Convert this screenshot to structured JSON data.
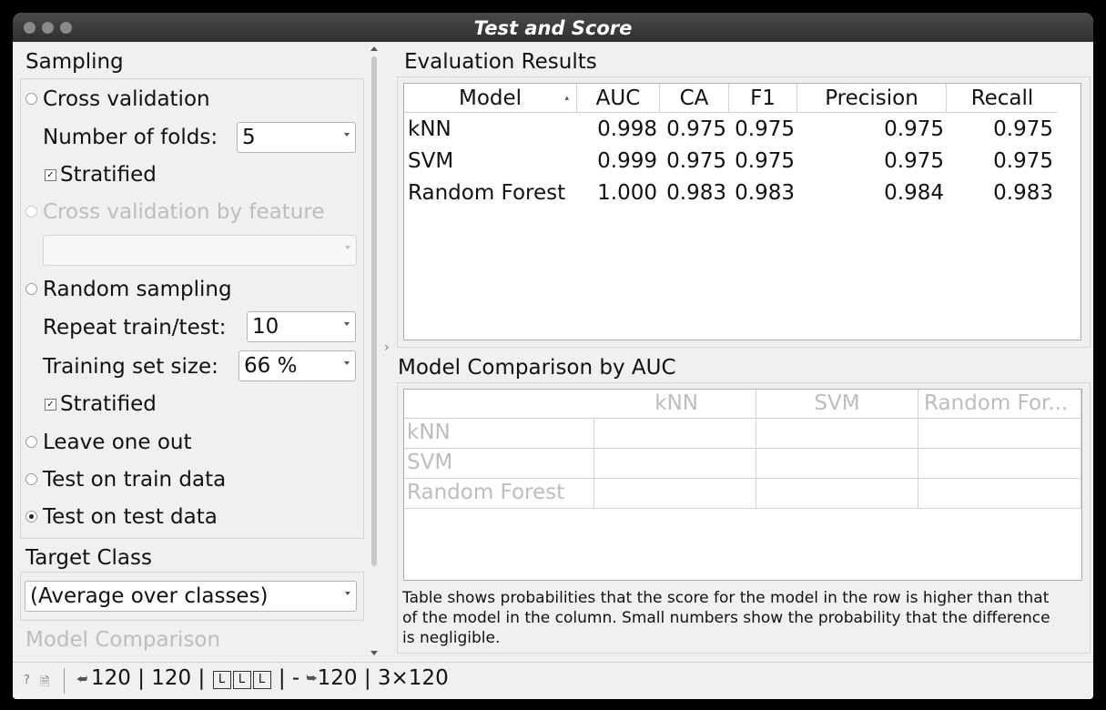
{
  "window": {
    "title": "Test and Score"
  },
  "sampling": {
    "header": "Sampling",
    "cross_validation": "Cross validation",
    "folds_label": "Number of folds:",
    "folds_value": "5",
    "stratified": "Stratified",
    "cv_by_feature": "Cross validation by feature",
    "random_sampling": "Random sampling",
    "repeat_label": "Repeat train/test:",
    "repeat_value": "10",
    "train_size_label": "Training set size:",
    "train_size_value": "66 %",
    "stratified2": "Stratified",
    "leave_one_out": "Leave one out",
    "test_on_train": "Test on train data",
    "test_on_test": "Test on test data"
  },
  "target": {
    "header": "Target Class",
    "value": "(Average over classes)"
  },
  "model_comparison_header": "Model Comparison",
  "evaluation": {
    "header": "Evaluation Results",
    "columns": [
      "Model",
      "AUC",
      "CA",
      "F1",
      "Precision",
      "Recall"
    ],
    "rows": [
      [
        "kNN",
        "0.998",
        "0.975",
        "0.975",
        "0.975",
        "0.975"
      ],
      [
        "SVM",
        "0.999",
        "0.975",
        "0.975",
        "0.975",
        "0.975"
      ],
      [
        "Random Forest",
        "1.000",
        "0.983",
        "0.983",
        "0.984",
        "0.983"
      ]
    ]
  },
  "comparison": {
    "header": "Model Comparison by AUC",
    "columns": [
      "kNN",
      "SVM",
      "Random For..."
    ],
    "rows": [
      "kNN",
      "SVM",
      "Random Forest"
    ],
    "note": "Table shows probabilities that the score for the model in the row is higher than that of the model in the column. Small numbers show the probability that the difference is negligible."
  },
  "status": {
    "input": "120 | 120 |",
    "badge": "L",
    "sep": "| -",
    "output": "120 | 3×120"
  }
}
